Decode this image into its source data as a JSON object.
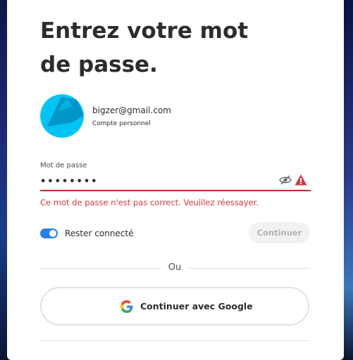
{
  "title": "Entrez votre mot de passe.",
  "account": {
    "email": "bigzer@gmail.com",
    "type": "Compte personnel"
  },
  "password": {
    "label": "Mot de passe",
    "value": "••••••••",
    "error": "Ce mot de passe n'est pas correct. Veuillez réessayer."
  },
  "stay_signed_in": {
    "label": "Rester connecté",
    "checked": true
  },
  "continue_button": "Continuer",
  "divider_text": "Ou",
  "google_button": "Continuer avec Google",
  "colors": {
    "error": "#d7373f",
    "accent": "#2680eb",
    "avatar": "#00c4f4"
  },
  "icons": [
    "hide-password-icon",
    "alert-icon",
    "google-icon"
  ]
}
